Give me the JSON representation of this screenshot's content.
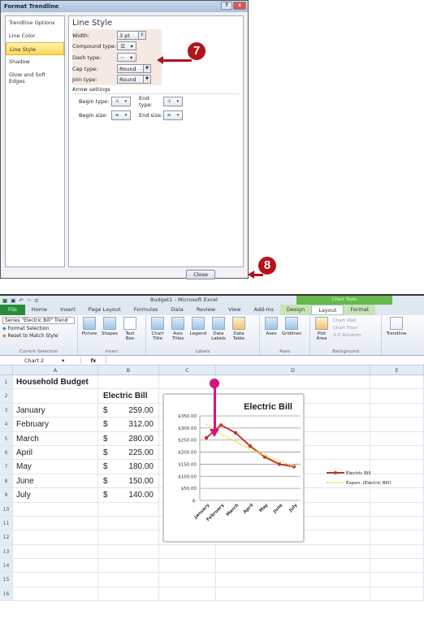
{
  "dialog": {
    "title": "Format Trendline",
    "nav": [
      "Trendline Options",
      "Line Color",
      "Line Style",
      "Shadow",
      "Glow and Soft Edges"
    ],
    "selected_nav": "Line Style",
    "panel_title": "Line Style",
    "width_label": "Width:",
    "width_value": "3 pt",
    "compound_label": "Compound type:",
    "dash_label": "Dash type:",
    "cap_label": "Cap type:",
    "cap_value": "Round",
    "join_label": "Join type:",
    "join_value": "Round",
    "arrow_section": "Arrow settings",
    "begin_type": "Begin type:",
    "end_type": "End type:",
    "begin_size": "Begin size:",
    "end_size": "End size:",
    "close": "Close",
    "help_icon": "?",
    "close_icon": "x"
  },
  "callouts": {
    "step7": "7",
    "step8": "8",
    "accent": "#b5121b",
    "pointer_color": "#d4147f"
  },
  "excel": {
    "window_title": "Budget1 - Microsoft Excel",
    "context_group": "Chart Tools",
    "tabs": [
      "File",
      "Home",
      "Insert",
      "Page Layout",
      "Formulas",
      "Data",
      "Review",
      "View",
      "Add-Ins"
    ],
    "context_tabs": [
      "Design",
      "Layout",
      "Format"
    ],
    "active_tab": "Layout",
    "current_selection": {
      "selector": "Series \"Electric Bill\" Trend",
      "format": "Format Selection",
      "reset": "Reset to Match Style",
      "label": "Current Selection"
    },
    "insert": {
      "items": [
        "Picture",
        "Shapes",
        "Text Box"
      ],
      "label": "Insert"
    },
    "labels": {
      "items": [
        "Chart Title",
        "Axis Titles",
        "Legend",
        "Data Labels",
        "Data Table"
      ],
      "label": "Labels"
    },
    "axes": {
      "items": [
        "Axes",
        "Gridlines"
      ],
      "label": "Axes"
    },
    "background": {
      "items": [
        "Plot Area",
        "Chart Wall",
        "Chart Floor",
        "3-D Rotation"
      ],
      "label": "Background"
    },
    "analysis": {
      "items": [
        "Trendline"
      ]
    },
    "name_box": "Chart 2",
    "fx": "fx",
    "columns": [
      "A",
      "B",
      "C",
      "D",
      "E"
    ],
    "rows": [
      {
        "n": "1",
        "a": "Household Budget",
        "cur": "",
        "b": ""
      },
      {
        "n": "2",
        "a": "",
        "cur": "",
        "b": "Electric Bill"
      },
      {
        "n": "3",
        "a": "January",
        "cur": "$",
        "b": "259.00"
      },
      {
        "n": "4",
        "a": "February",
        "cur": "$",
        "b": "312.00"
      },
      {
        "n": "5",
        "a": "March",
        "cur": "$",
        "b": "280.00"
      },
      {
        "n": "6",
        "a": "April",
        "cur": "$",
        "b": "225.00"
      },
      {
        "n": "7",
        "a": "May",
        "cur": "$",
        "b": "180.00"
      },
      {
        "n": "8",
        "a": "June",
        "cur": "$",
        "b": "150.00"
      },
      {
        "n": "9",
        "a": "July",
        "cur": "$",
        "b": "140.00"
      },
      {
        "n": "10"
      },
      {
        "n": "11"
      },
      {
        "n": "12"
      },
      {
        "n": "13"
      },
      {
        "n": "14"
      },
      {
        "n": "15"
      },
      {
        "n": "16"
      }
    ]
  },
  "chart_data": {
    "type": "line",
    "title": "Electric Bill",
    "categories": [
      "January",
      "February",
      "March",
      "April",
      "May",
      "June",
      "July"
    ],
    "series": [
      {
        "name": "Electric Bill",
        "values": [
          259,
          312,
          280,
          225,
          180,
          150,
          140
        ],
        "color": "#c0392b"
      },
      {
        "name": "Expon. (Electric Bill)",
        "values": [
          316,
          275,
          243,
          213,
          187,
          163,
          142
        ],
        "color": "#f2e05a",
        "dashed": true
      }
    ],
    "yticks": [
      "$350.00",
      "$300.00",
      "$250.00",
      "$200.00",
      "$150.00",
      "$100.00",
      "$50.00",
      "$-"
    ],
    "ylim": [
      0,
      350
    ],
    "grid": true,
    "legend": "right"
  }
}
